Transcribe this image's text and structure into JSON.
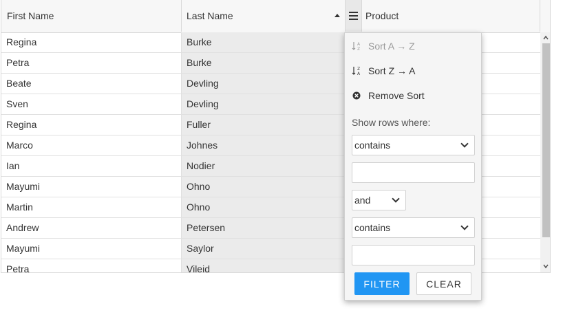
{
  "grid": {
    "columns": [
      {
        "label": "First Name"
      },
      {
        "label": "Last Name"
      },
      {
        "label": "Product"
      }
    ],
    "rows": [
      {
        "first": "Regina",
        "last": "Burke"
      },
      {
        "first": "Petra",
        "last": "Burke"
      },
      {
        "first": "Beate",
        "last": "Devling"
      },
      {
        "first": "Sven",
        "last": "Devling"
      },
      {
        "first": "Regina",
        "last": "Fuller"
      },
      {
        "first": "Marco",
        "last": "Johnes"
      },
      {
        "first": "Ian",
        "last": "Nodier"
      },
      {
        "first": "Mayumi",
        "last": "Ohno"
      },
      {
        "first": "Martin",
        "last": "Ohno"
      },
      {
        "first": "Andrew",
        "last": "Petersen"
      },
      {
        "first": "Mayumi",
        "last": "Saylor"
      },
      {
        "first": "Petra",
        "last": "Vileid"
      }
    ]
  },
  "column_menu": {
    "sort_asc_label": "Sort A → Z",
    "sort_desc_label": "Sort Z → A",
    "remove_sort_label": "Remove Sort",
    "show_rows_label": "Show rows where:",
    "condition1": "contains",
    "value1": "",
    "operator": "and",
    "condition2": "contains",
    "value2": "",
    "filter_label": "FILTER",
    "clear_label": "CLEAR"
  },
  "colors": {
    "accent": "#2196f3",
    "sorted_column_bg": "#ebebeb"
  }
}
